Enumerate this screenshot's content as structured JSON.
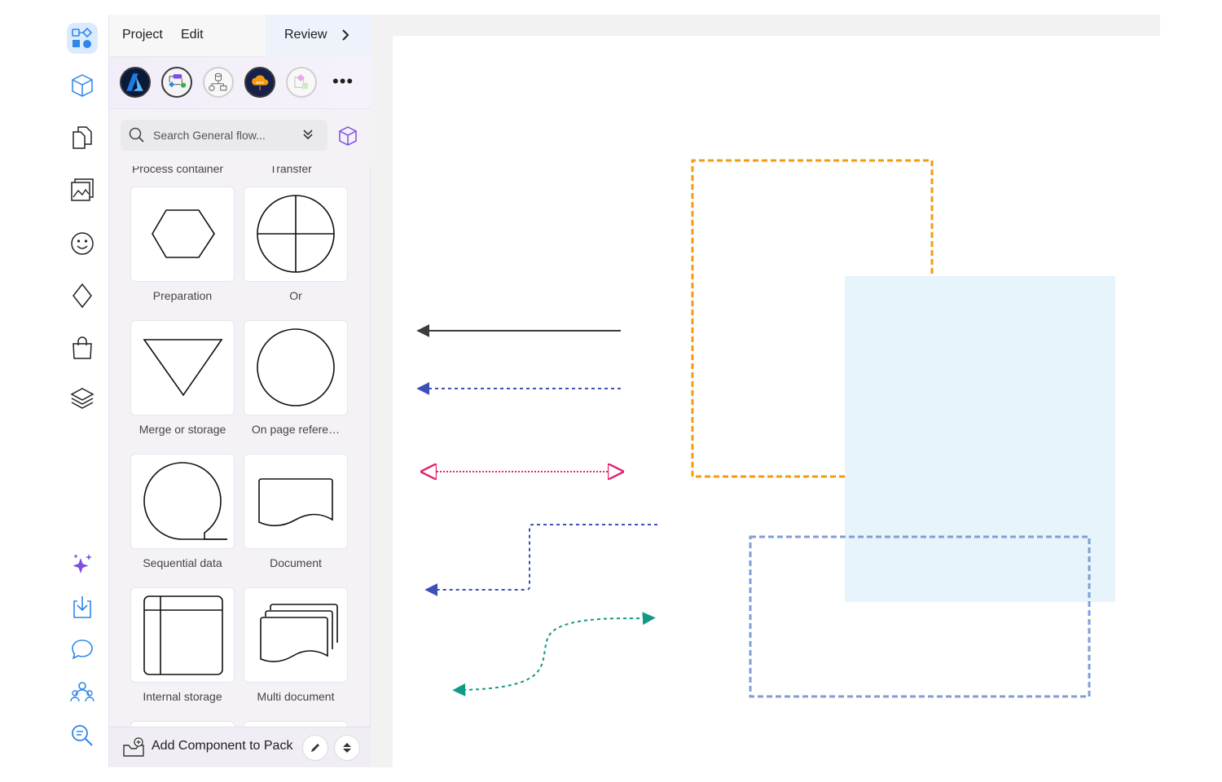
{
  "menu": {
    "project": "Project",
    "edit": "Edit",
    "review": "Review"
  },
  "rail": {
    "top_items": [
      "shapes-icon",
      "cube-icon",
      "pages-icon",
      "image-icon",
      "emoji-icon",
      "diamond-icon",
      "shopping-bag-icon",
      "layers-icon"
    ],
    "bottom_items": [
      "sparkles-icon",
      "import-icon",
      "comment-icon",
      "collaborators-icon",
      "zoom-search-icon"
    ],
    "accent": "#2f86eb"
  },
  "packs": [
    "azure-pack",
    "flowchart-pack",
    "network-pack",
    "aws-pack",
    "misc-pack"
  ],
  "search": {
    "placeholder": "Search General flow..."
  },
  "shapes": {
    "peek_labels": [
      "Process container",
      "Transfer"
    ],
    "tiles": [
      {
        "label": "Preparation",
        "icon": "hexagon"
      },
      {
        "label": "Or",
        "icon": "circle-cross"
      },
      {
        "label": "Merge or storage",
        "icon": "triangle-down"
      },
      {
        "label": "On page refere…",
        "icon": "circle"
      },
      {
        "label": "Sequential data",
        "icon": "sequential-data"
      },
      {
        "label": "Document",
        "icon": "document"
      },
      {
        "label": "Internal storage",
        "icon": "internal-storage"
      },
      {
        "label": "Multi document",
        "icon": "multi-document"
      }
    ]
  },
  "footer": {
    "add_label": "Add Component to Pack"
  },
  "canvas": {
    "connector_colors": {
      "solid": "#3d3d3d",
      "blue": "#3d4fb8",
      "pink": "#e0266f",
      "teal": "#139a86"
    },
    "box_colors": {
      "orange": "#f39c12",
      "light_blue_fill": "#e7f4fb",
      "blue_dashed": "#7f9fd6"
    }
  }
}
